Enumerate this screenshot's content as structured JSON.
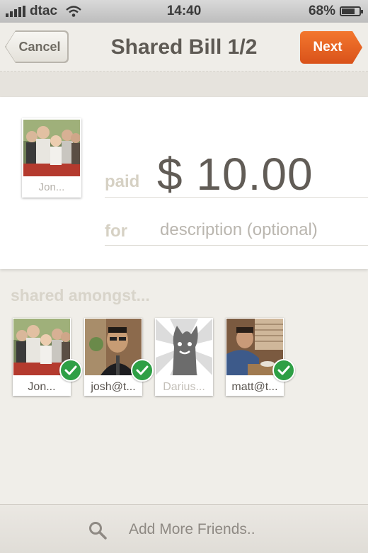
{
  "status_bar": {
    "carrier": "dtac",
    "time": "14:40",
    "battery_percent": "68%",
    "battery_level": 0.68
  },
  "nav": {
    "cancel_label": "Cancel",
    "title": "Shared Bill 1/2",
    "next_label": "Next",
    "accent_color": "#e5622a"
  },
  "payment": {
    "payer_name": "Jon...",
    "paid_label": "paid",
    "amount": "$ 10.00",
    "for_label": "for",
    "description_placeholder": "description (optional)"
  },
  "shared": {
    "label": "shared amongst...",
    "friends": [
      {
        "name": "Jon...",
        "selected": true,
        "icon": "family-photo"
      },
      {
        "name": "josh@t...",
        "selected": true,
        "icon": "man-photo"
      },
      {
        "name": "Darius...",
        "selected": false,
        "icon": "default-avatar"
      },
      {
        "name": "matt@t...",
        "selected": true,
        "icon": "man-at-table-photo"
      }
    ]
  },
  "bottom": {
    "add_friends_label": "Add More Friends..",
    "icon": "search-icon"
  }
}
